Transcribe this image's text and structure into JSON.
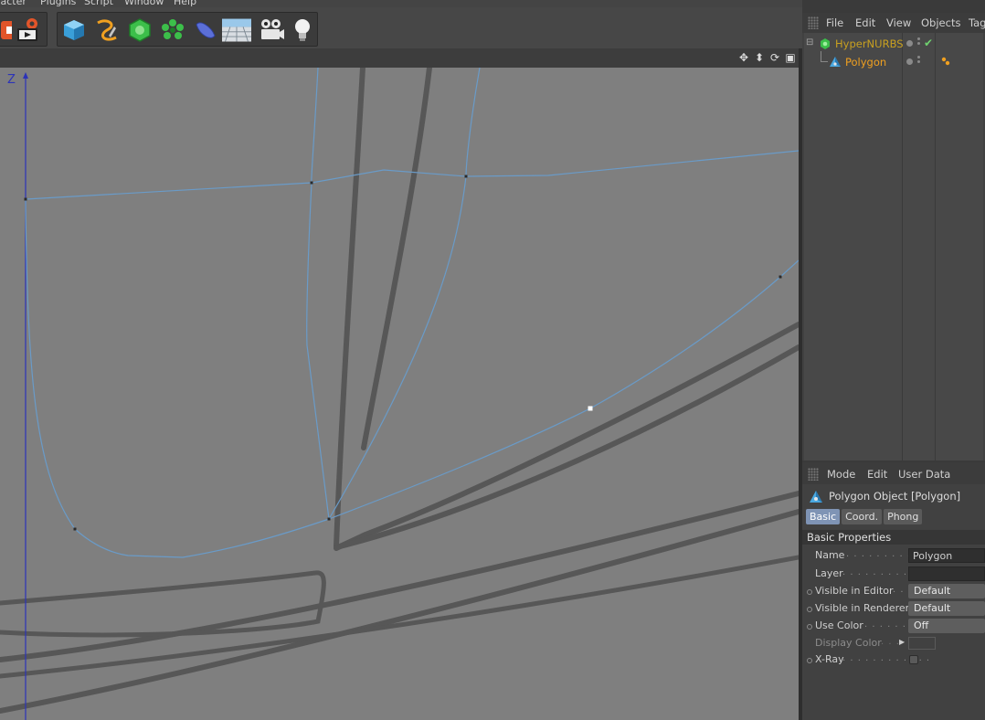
{
  "menubar": {
    "items": [
      "racter",
      "Plugins",
      "Script",
      "Window",
      "Help"
    ]
  },
  "toolbar": {
    "buttons": [
      {
        "icon": "render-icon"
      },
      {
        "icon": "render-settings-icon"
      },
      {
        "icon": "cube-primitive-icon"
      },
      {
        "icon": "spline-pen-icon"
      },
      {
        "icon": "hypernurbs-icon"
      },
      {
        "icon": "array-icon"
      },
      {
        "icon": "deformer-icon"
      },
      {
        "icon": "floor-environment-icon"
      },
      {
        "icon": "camera-icon"
      },
      {
        "icon": "light-icon"
      }
    ]
  },
  "viewport": {
    "axis_label": "Z",
    "background": "#7f7f7f",
    "spline_color": "#6a9bc8",
    "sketch_color": "#575757",
    "axis_color": "#2c33b8"
  },
  "object_manager": {
    "menu": [
      "File",
      "Edit",
      "View",
      "Objects",
      "Tag"
    ],
    "objects": [
      {
        "name": "HyperNURBS",
        "icon": "hypernurbs-icon",
        "color": "#c8a020",
        "enabled_check": "✔"
      },
      {
        "name": "Polygon",
        "icon": "polygon-object-icon",
        "color": "#f0a020"
      }
    ]
  },
  "attribute_manager": {
    "menu": [
      "Mode",
      "Edit",
      "User Data"
    ],
    "title": "Polygon Object [Polygon]",
    "tabs": [
      {
        "label": "Basic",
        "active": true
      },
      {
        "label": "Coord.",
        "active": false
      },
      {
        "label": "Phong",
        "active": false
      }
    ],
    "section": "Basic Properties",
    "properties": {
      "name": {
        "label": "Name",
        "value": "Polygon"
      },
      "layer": {
        "label": "Layer",
        "value": ""
      },
      "visible_editor": {
        "label": "Visible in Editor",
        "value": "Default"
      },
      "visible_renderer": {
        "label": "Visible in Renderer",
        "value": "Default"
      },
      "use_color": {
        "label": "Use Color",
        "value": "Off"
      },
      "display_color": {
        "label": "Display Color"
      },
      "xray": {
        "label": "X-Ray"
      }
    }
  }
}
